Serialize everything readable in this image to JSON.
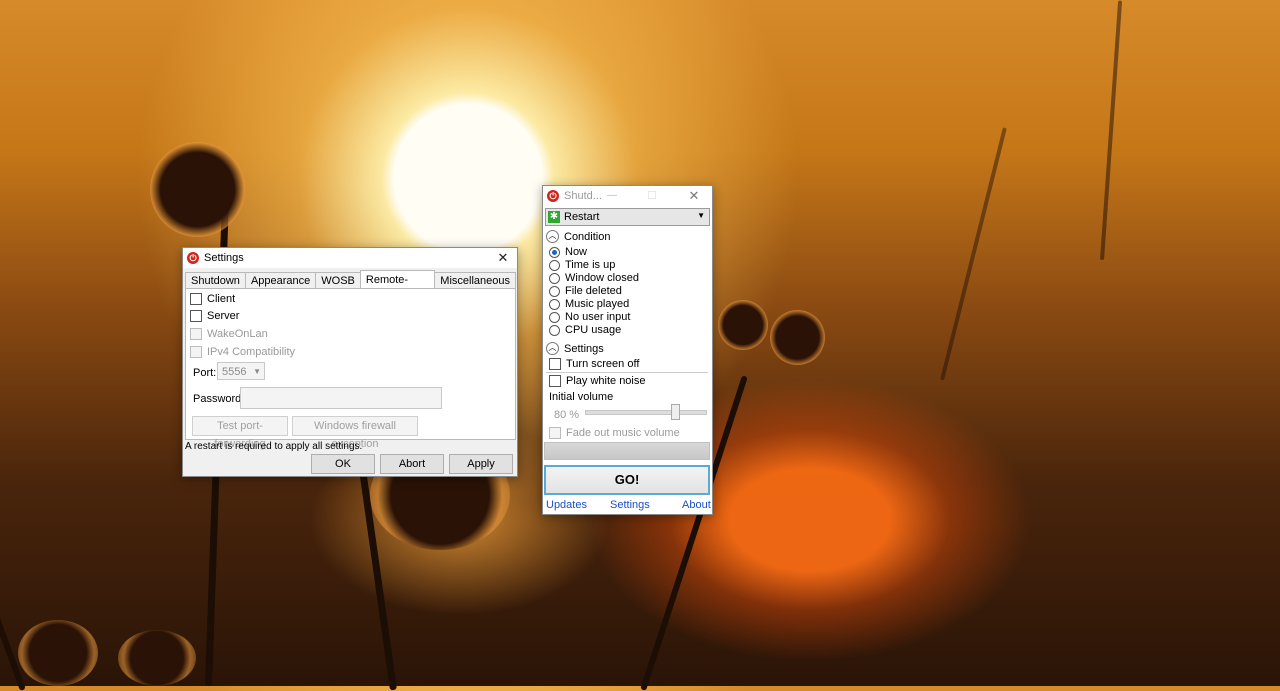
{
  "settings_window": {
    "title": "Settings",
    "close_glyph": "✕",
    "tabs": [
      "Shutdown",
      "Appearance",
      "WOSB",
      "Remote-Shutdown",
      "Miscellaneous"
    ],
    "active_tab": "Remote-Shutdown",
    "checkboxes": [
      "Client",
      "Server",
      "WakeOnLan",
      "IPv4 Compatibility"
    ],
    "port_label": "Port:",
    "port_value": "5556",
    "password_label": "Password:",
    "test_button": "Test port-forwarding",
    "firewall_button": "Windows firewall exception",
    "status_text": "A restart is required to apply all settings.",
    "ok_button": "OK",
    "abort_button": "Abort",
    "apply_button": "Apply"
  },
  "main_window": {
    "title": "Shutd...",
    "minimize_glyph": "—",
    "maximize_glyph": "☐",
    "close_glyph": "✕",
    "action_selected": "Restart",
    "condition_header": "Condition",
    "conditions": [
      "Now",
      "Time is up",
      "Window closed",
      "File deleted",
      "Music played",
      "No user input",
      "CPU usage"
    ],
    "selected_condition": "Now",
    "settings_header": "Settings",
    "turn_screen_off": "Turn screen off",
    "play_white_noise": "Play white noise",
    "initial_volume_label": "Initial volume",
    "volume_value": "80 %",
    "volume_level": 0.8,
    "fade_out": "Fade out music volume",
    "go_button": "GO!",
    "links": {
      "updates": "Updates",
      "settings": "Settings",
      "about": "About"
    }
  },
  "colors": {
    "accent": "#1a4fc4",
    "app_icon": "#d5231a",
    "restart_icon": "#2ea82e"
  }
}
